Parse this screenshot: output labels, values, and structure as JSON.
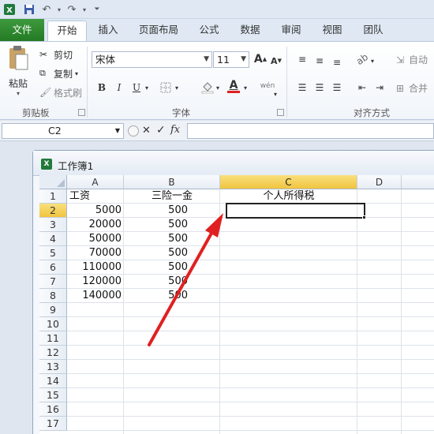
{
  "qat": {
    "app_icon": "excel-icon",
    "save_icon": "save-icon",
    "undo_icon": "undo-icon",
    "redo_icon": "redo-icon",
    "customize_icon": "customize-dropdown-icon"
  },
  "tabs": [
    "文件",
    "开始",
    "插入",
    "页面布局",
    "公式",
    "数据",
    "审阅",
    "视图",
    "团队"
  ],
  "ribbon": {
    "clipboard": {
      "paste": "粘贴",
      "cut": "剪切",
      "copy": "复制",
      "format_painter": "格式刷",
      "group": "剪贴板"
    },
    "font": {
      "name": "宋体",
      "size": "11",
      "bold": "B",
      "italic": "I",
      "underline": "U",
      "grow": "A",
      "shrink": "A",
      "color_a": "A",
      "phonetic": "wén",
      "group": "字体"
    },
    "alignment": {
      "wrap": "自动",
      "merge": "合并",
      "group": "对齐方式"
    }
  },
  "formula_bar": {
    "name_box": "C2",
    "cancel": "✕",
    "enter": "✓",
    "fx": "fx",
    "value": ""
  },
  "workbook": {
    "title": "工作簿1",
    "icon_letter": "X"
  },
  "sheet": {
    "columns": [
      "A",
      "B",
      "C",
      "D"
    ],
    "rows": [
      "1",
      "2",
      "3",
      "4",
      "5",
      "6",
      "7",
      "8",
      "9",
      "10",
      "11",
      "12",
      "13",
      "14",
      "15",
      "16",
      "17"
    ],
    "selected_cell": "C2",
    "headers": {
      "A": "工资",
      "B": "三险一金",
      "C": "个人所得税"
    },
    "data": [
      {
        "row": "2",
        "A": "5000",
        "B": "500"
      },
      {
        "row": "3",
        "A": "20000",
        "B": "500"
      },
      {
        "row": "4",
        "A": "50000",
        "B": "500"
      },
      {
        "row": "5",
        "A": "70000",
        "B": "500"
      },
      {
        "row": "6",
        "A": "110000",
        "B": "500"
      },
      {
        "row": "7",
        "A": "120000",
        "B": "500"
      },
      {
        "row": "8",
        "A": "140000",
        "B": "500"
      }
    ]
  },
  "colors": {
    "file_tab": "#2e8b2e",
    "selected_header": "#f3c94a",
    "arrow": "#e02020"
  }
}
